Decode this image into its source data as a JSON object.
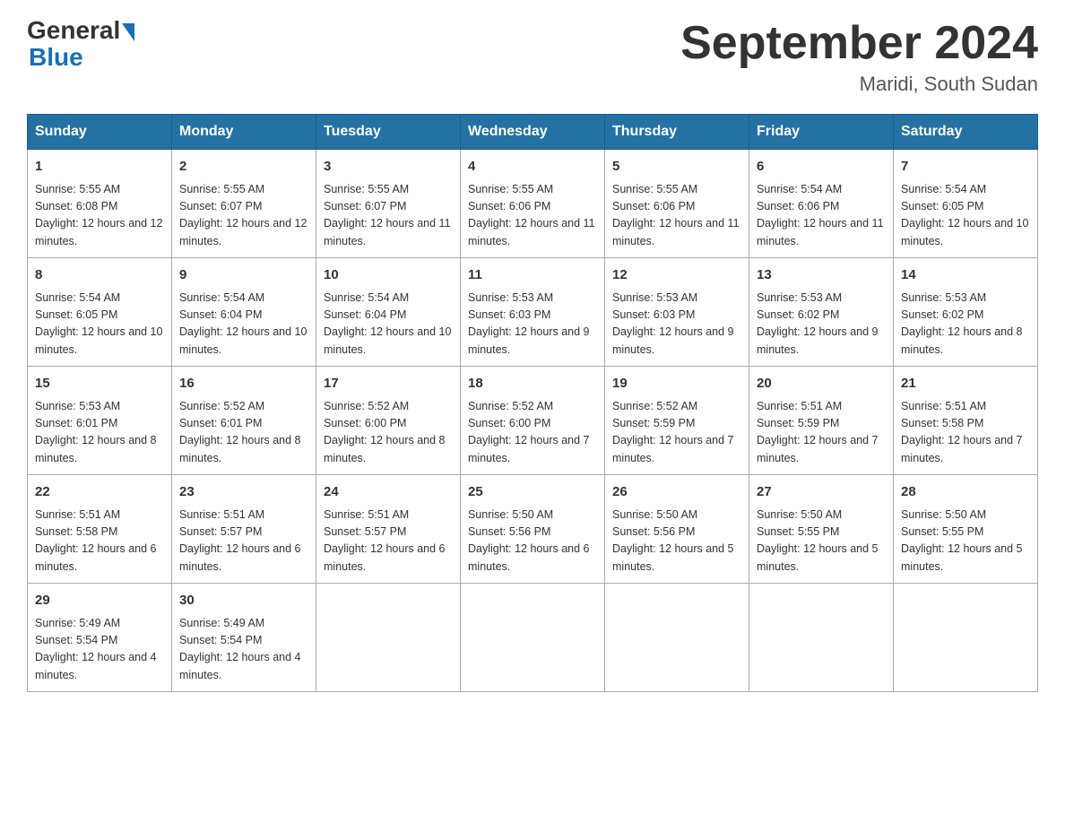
{
  "header": {
    "logo_line1": "General",
    "logo_line2": "Blue",
    "month_title": "September 2024",
    "location": "Maridi, South Sudan"
  },
  "days_of_week": [
    "Sunday",
    "Monday",
    "Tuesday",
    "Wednesday",
    "Thursday",
    "Friday",
    "Saturday"
  ],
  "weeks": [
    [
      {
        "day": "1",
        "sunrise": "5:55 AM",
        "sunset": "6:08 PM",
        "daylight": "12 hours and 12 minutes."
      },
      {
        "day": "2",
        "sunrise": "5:55 AM",
        "sunset": "6:07 PM",
        "daylight": "12 hours and 12 minutes."
      },
      {
        "day": "3",
        "sunrise": "5:55 AM",
        "sunset": "6:07 PM",
        "daylight": "12 hours and 11 minutes."
      },
      {
        "day": "4",
        "sunrise": "5:55 AM",
        "sunset": "6:06 PM",
        "daylight": "12 hours and 11 minutes."
      },
      {
        "day": "5",
        "sunrise": "5:55 AM",
        "sunset": "6:06 PM",
        "daylight": "12 hours and 11 minutes."
      },
      {
        "day": "6",
        "sunrise": "5:54 AM",
        "sunset": "6:06 PM",
        "daylight": "12 hours and 11 minutes."
      },
      {
        "day": "7",
        "sunrise": "5:54 AM",
        "sunset": "6:05 PM",
        "daylight": "12 hours and 10 minutes."
      }
    ],
    [
      {
        "day": "8",
        "sunrise": "5:54 AM",
        "sunset": "6:05 PM",
        "daylight": "12 hours and 10 minutes."
      },
      {
        "day": "9",
        "sunrise": "5:54 AM",
        "sunset": "6:04 PM",
        "daylight": "12 hours and 10 minutes."
      },
      {
        "day": "10",
        "sunrise": "5:54 AM",
        "sunset": "6:04 PM",
        "daylight": "12 hours and 10 minutes."
      },
      {
        "day": "11",
        "sunrise": "5:53 AM",
        "sunset": "6:03 PM",
        "daylight": "12 hours and 9 minutes."
      },
      {
        "day": "12",
        "sunrise": "5:53 AM",
        "sunset": "6:03 PM",
        "daylight": "12 hours and 9 minutes."
      },
      {
        "day": "13",
        "sunrise": "5:53 AM",
        "sunset": "6:02 PM",
        "daylight": "12 hours and 9 minutes."
      },
      {
        "day": "14",
        "sunrise": "5:53 AM",
        "sunset": "6:02 PM",
        "daylight": "12 hours and 8 minutes."
      }
    ],
    [
      {
        "day": "15",
        "sunrise": "5:53 AM",
        "sunset": "6:01 PM",
        "daylight": "12 hours and 8 minutes."
      },
      {
        "day": "16",
        "sunrise": "5:52 AM",
        "sunset": "6:01 PM",
        "daylight": "12 hours and 8 minutes."
      },
      {
        "day": "17",
        "sunrise": "5:52 AM",
        "sunset": "6:00 PM",
        "daylight": "12 hours and 8 minutes."
      },
      {
        "day": "18",
        "sunrise": "5:52 AM",
        "sunset": "6:00 PM",
        "daylight": "12 hours and 7 minutes."
      },
      {
        "day": "19",
        "sunrise": "5:52 AM",
        "sunset": "5:59 PM",
        "daylight": "12 hours and 7 minutes."
      },
      {
        "day": "20",
        "sunrise": "5:51 AM",
        "sunset": "5:59 PM",
        "daylight": "12 hours and 7 minutes."
      },
      {
        "day": "21",
        "sunrise": "5:51 AM",
        "sunset": "5:58 PM",
        "daylight": "12 hours and 7 minutes."
      }
    ],
    [
      {
        "day": "22",
        "sunrise": "5:51 AM",
        "sunset": "5:58 PM",
        "daylight": "12 hours and 6 minutes."
      },
      {
        "day": "23",
        "sunrise": "5:51 AM",
        "sunset": "5:57 PM",
        "daylight": "12 hours and 6 minutes."
      },
      {
        "day": "24",
        "sunrise": "5:51 AM",
        "sunset": "5:57 PM",
        "daylight": "12 hours and 6 minutes."
      },
      {
        "day": "25",
        "sunrise": "5:50 AM",
        "sunset": "5:56 PM",
        "daylight": "12 hours and 6 minutes."
      },
      {
        "day": "26",
        "sunrise": "5:50 AM",
        "sunset": "5:56 PM",
        "daylight": "12 hours and 5 minutes."
      },
      {
        "day": "27",
        "sunrise": "5:50 AM",
        "sunset": "5:55 PM",
        "daylight": "12 hours and 5 minutes."
      },
      {
        "day": "28",
        "sunrise": "5:50 AM",
        "sunset": "5:55 PM",
        "daylight": "12 hours and 5 minutes."
      }
    ],
    [
      {
        "day": "29",
        "sunrise": "5:49 AM",
        "sunset": "5:54 PM",
        "daylight": "12 hours and 4 minutes."
      },
      {
        "day": "30",
        "sunrise": "5:49 AM",
        "sunset": "5:54 PM",
        "daylight": "12 hours and 4 minutes."
      },
      null,
      null,
      null,
      null,
      null
    ]
  ]
}
